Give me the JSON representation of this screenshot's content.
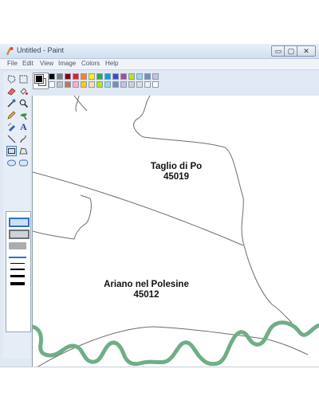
{
  "window": {
    "title": "Untitled - Paint"
  },
  "title_buttons": {
    "minimize": "▭",
    "maximize": "▢",
    "close": "✕"
  },
  "menu": [
    "File",
    "Edit",
    "View",
    "Image",
    "Colors",
    "Help"
  ],
  "tools": [
    "free-form-select-icon",
    "select-icon",
    "eraser-icon",
    "fill-icon",
    "pick-color-icon",
    "magnifier-icon",
    "pencil-icon",
    "brush-icon",
    "airbrush-icon",
    "text-icon",
    "line-icon",
    "curve-icon",
    "rectangle-icon",
    "polygon-icon",
    "ellipse-icon",
    "rounded-rectangle-icon"
  ],
  "palette_colors": [
    "#000000",
    "#7f7f7f",
    "#880015",
    "#ed1c24",
    "#ff7f27",
    "#fff200",
    "#22b14c",
    "#00a2e8",
    "#3f48cc",
    "#a349a4",
    "#b5e61d",
    "#99d9ea",
    "#7092be",
    "#c8bfe7",
    "#ffffff",
    "#c3c3c3",
    "#b97a57",
    "#ffaec9",
    "#ffc90e",
    "#efe4b0",
    "#b5e61d",
    "#99d9ea",
    "#7092be",
    "#c8bfe7",
    "#d0d0d0",
    "#e0e0e0",
    "#f0f0f0",
    "#ffffff"
  ],
  "colors": {
    "river": "#6fae87",
    "border_line": "#6d6d6d",
    "foreground": "#000000",
    "background": "#ffffff"
  },
  "map": {
    "place1": {
      "name": "Taglio di Po",
      "code": "45019"
    },
    "place2": {
      "name": "Ariano nel Polesine",
      "code": "45012"
    }
  }
}
